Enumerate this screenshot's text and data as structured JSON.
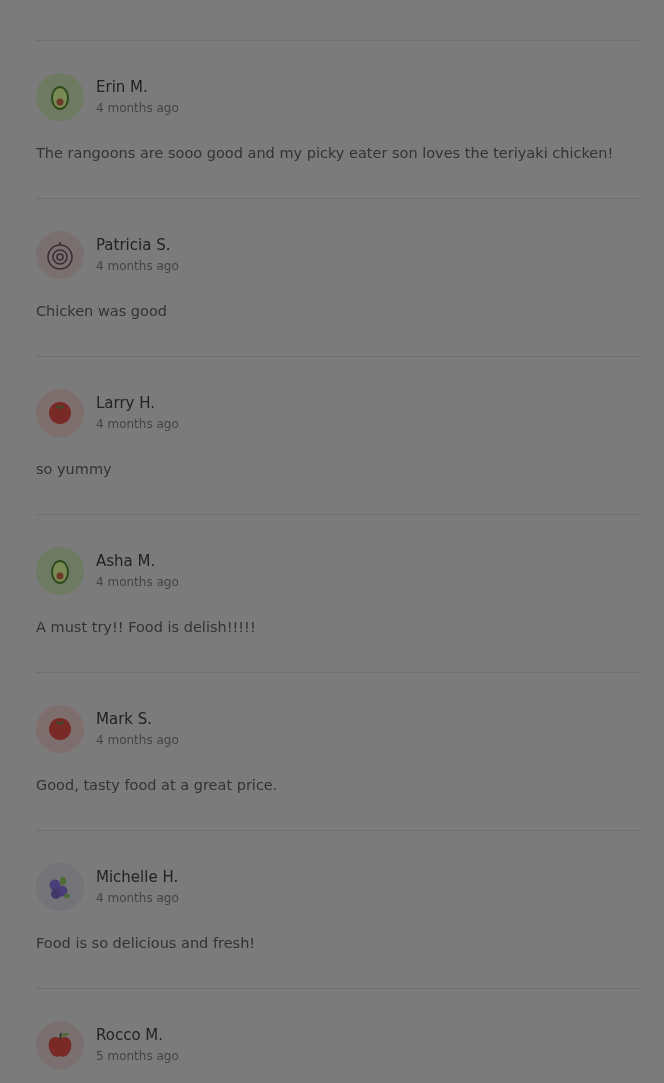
{
  "reviews": [
    {
      "name": "Erin M.",
      "time": "4 months ago",
      "text": "The rangoons are sooo good and my picky eater son loves the teriyaki chicken!",
      "avatar": {
        "kind": "avocado"
      }
    },
    {
      "name": "Patricia S.",
      "time": "4 months ago",
      "text": "Chicken was good",
      "avatar": {
        "kind": "onion"
      }
    },
    {
      "name": "Larry H.",
      "time": "4 months ago",
      "text": "so yummy",
      "avatar": {
        "kind": "tomato"
      }
    },
    {
      "name": "Asha M.",
      "time": "4 months ago",
      "text": "A must try!! Food is delish!!!!!",
      "avatar": {
        "kind": "avocado"
      }
    },
    {
      "name": "Mark S.",
      "time": "4 months ago",
      "text": "Good, tasty food at a great price.",
      "avatar": {
        "kind": "tomato"
      }
    },
    {
      "name": "Michelle H.",
      "time": "4 months ago",
      "text": "Food is so delicious and fresh!",
      "avatar": {
        "kind": "blueberry"
      }
    },
    {
      "name": "Rocco M.",
      "time": "5 months ago",
      "avatar": {
        "kind": "apple"
      }
    }
  ]
}
